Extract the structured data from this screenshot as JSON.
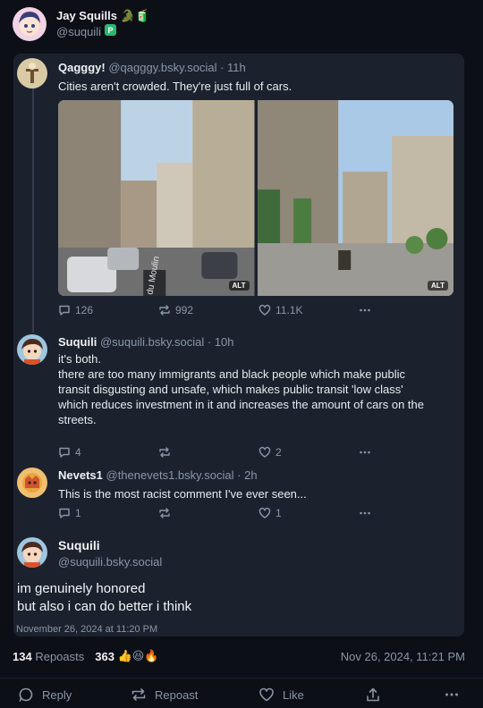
{
  "author": {
    "name": "Jay Squills",
    "name_emojis": "🐊🧃",
    "handle": "@suquili"
  },
  "posts": [
    {
      "name": "Qagggy!",
      "handle": "@qagggy.bsky.social",
      "time": "· 11h",
      "text": "Cities aren't crowded. They're just full of cars.",
      "replies": "126",
      "reposts": "992",
      "likes": "11.1K",
      "alt_label": "ALT",
      "street_sign": "Rue du Moulin"
    },
    {
      "name": "Suquili",
      "handle": "@suquili.bsky.social",
      "time": "· 10h",
      "text_lines": [
        "it's both.",
        "there are too many immigrants and black people which make public",
        "transit disgusting and unsafe, which makes public transit 'low class'",
        "which reduces investment in it and increases the amount of cars on the",
        "streets."
      ],
      "replies": "4",
      "reposts": "",
      "likes": "2"
    },
    {
      "name": "Nevets1",
      "handle": "@thenevets1.bsky.social",
      "time": "· 2h",
      "text": "This is the most racist comment I've ever seen...",
      "replies": "1",
      "reposts": "",
      "likes": "1"
    }
  ],
  "focus_post": {
    "name": "Suquili",
    "handle": "@suquili.bsky.social",
    "text_lines": [
      "im genuinely honored",
      "but also i can do better i think"
    ],
    "date": "November 26, 2024 at 11:20 PM"
  },
  "stats": {
    "reposts_count": "134",
    "reposts_label": "Repoasts",
    "likes_count": "363",
    "likes_emojis": "👍😆🔥",
    "timestamp": "Nov 26, 2024, 11:21 PM"
  },
  "bottom_actions": {
    "reply": "Reply",
    "repost": "Repoast",
    "like": "Like"
  },
  "icons": [
    "reply-icon",
    "repost-icon",
    "like-icon",
    "more-icon",
    "share-icon"
  ],
  "colors": {
    "background": "#0c0f16",
    "card": "#1c222d",
    "muted": "#8a96a6",
    "text": "#e7ebf0",
    "verified": "#2bb673"
  }
}
